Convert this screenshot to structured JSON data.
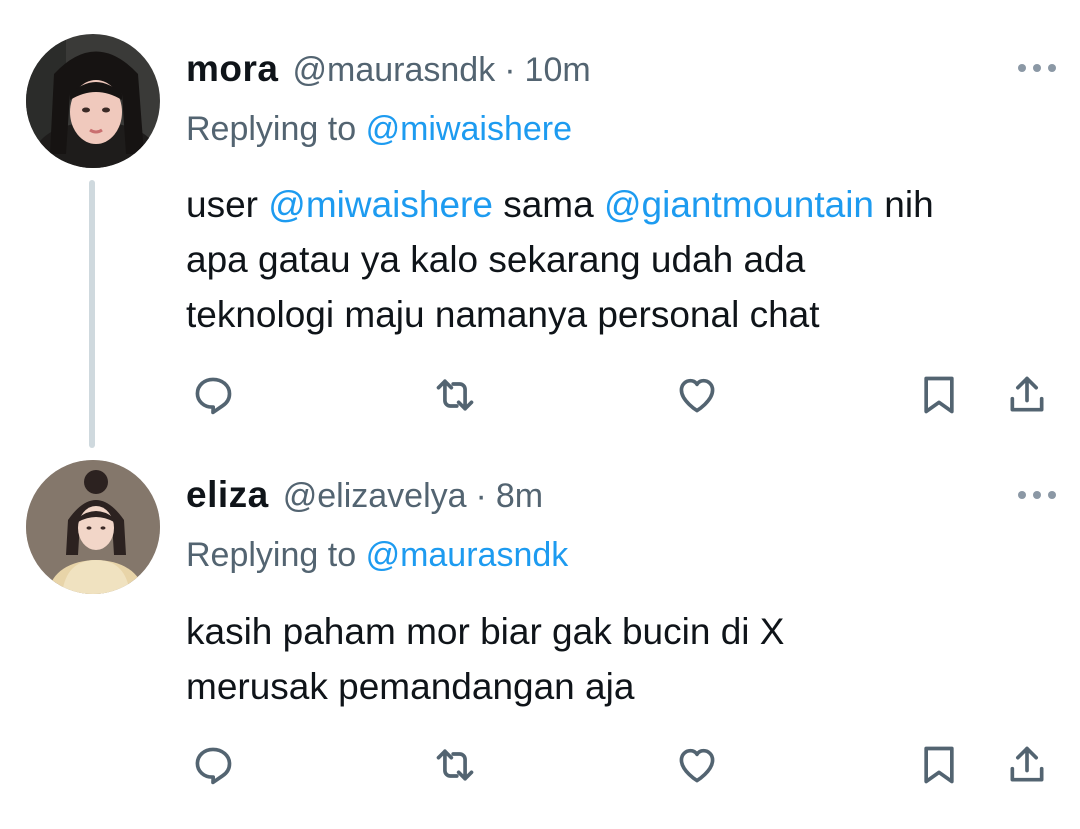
{
  "tweets": [
    {
      "name": "mora",
      "handle": "@maurasndk",
      "separator": "·",
      "time": "10m",
      "replying_prefix": "Replying to",
      "replying_to": "@miwaishere",
      "body": {
        "l1a": "user",
        "l1b": "@miwaishere",
        "l1c": "sama",
        "l1d": "@giantmountain",
        "l1e": "nih",
        "l2": "apa gatau ya kalo sekarang udah ada",
        "l3": "teknologi maju namanya personal chat"
      }
    },
    {
      "name": "eliza",
      "handle": "@elizavelya",
      "separator": "·",
      "time": "8m",
      "replying_prefix": "Replying to",
      "replying_to": "@maurasndk",
      "body": {
        "l1": "kasih paham mor biar gak bucin di X",
        "l2": "merusak pemandangan aja"
      }
    }
  ],
  "colors": {
    "text": "#0f1419",
    "secondary": "#536471",
    "link": "#1d9bf0",
    "thread_line": "#cfd9de",
    "icon": "#536471"
  },
  "icons": [
    "reply-icon",
    "retweet-icon",
    "like-icon",
    "bookmark-icon",
    "share-icon",
    "more-icon"
  ]
}
